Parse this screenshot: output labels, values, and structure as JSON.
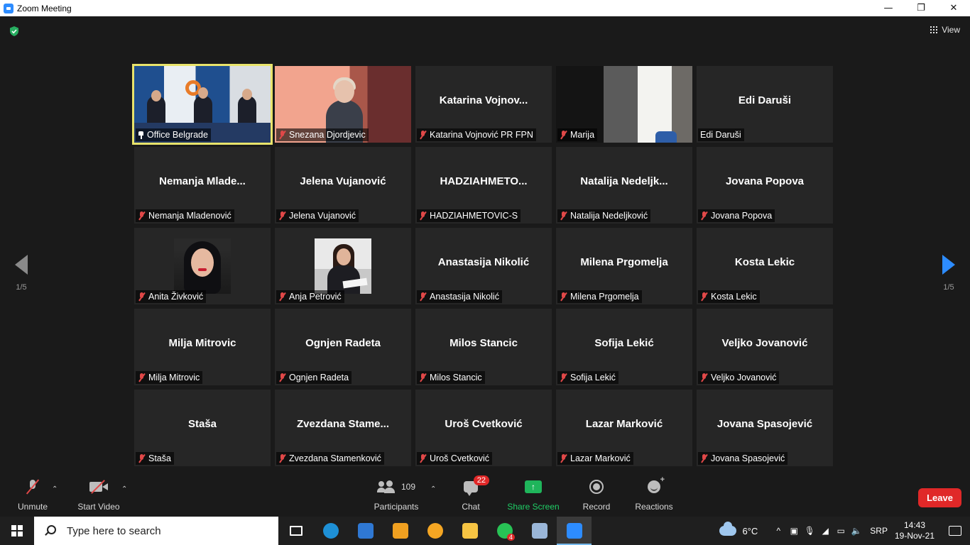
{
  "window": {
    "title": "Zoom Meeting",
    "controls": {
      "minimize": "—",
      "restore": "❐",
      "close": "✕"
    }
  },
  "top": {
    "security_icon": "shield-check-icon",
    "view_label": "View"
  },
  "pager": {
    "left": "1/5",
    "right": "1/5"
  },
  "tiles": [
    {
      "display": "",
      "label": "Office Belgrade",
      "muted": false,
      "video": "office",
      "active": true
    },
    {
      "display": "",
      "label": "Snezana Djordjevic",
      "muted": true,
      "video": "snezana"
    },
    {
      "display": "Katarina  Vojnov...",
      "label": "Katarina Vojnović PR FPN",
      "muted": true
    },
    {
      "display": "",
      "label": "Marija",
      "muted": true,
      "video": "marija"
    },
    {
      "display": "Edi Daruši",
      "label": "Edi Daruši",
      "muted": false
    },
    {
      "display": "Nemanja  Mlade...",
      "label": "Nemanja Mladenović",
      "muted": true
    },
    {
      "display": "Jelena Vujanović",
      "label": "Jelena Vujanović",
      "muted": true
    },
    {
      "display": "HADZIAHMETO...",
      "label": "HADZIAHMETOVIC-S",
      "muted": true
    },
    {
      "display": "Natalija  Nedeljk...",
      "label": "Natalija Nedeljković",
      "muted": true
    },
    {
      "display": "Jovana Popova",
      "label": "Jovana Popova",
      "muted": true
    },
    {
      "display": "",
      "label": "Anita Živković",
      "muted": true,
      "avatar": "anita"
    },
    {
      "display": "",
      "label": "Anja Petrović",
      "muted": true,
      "avatar": "anja"
    },
    {
      "display": "Anastasija Nikolić",
      "label": "Anastasija Nikolić",
      "muted": true
    },
    {
      "display": "Milena Prgomelja",
      "label": "Milena Prgomelja",
      "muted": true
    },
    {
      "display": "Kosta Lekic",
      "label": "Kosta Lekic",
      "muted": true
    },
    {
      "display": "Milja Mitrovic",
      "label": "Milja Mitrovic",
      "muted": true
    },
    {
      "display": "Ognjen Radeta",
      "label": "Ognjen Radeta",
      "muted": true
    },
    {
      "display": "Milos Stancic",
      "label": "Milos Stancic",
      "muted": true
    },
    {
      "display": "Sofija Lekić",
      "label": "Sofija Lekić",
      "muted": true
    },
    {
      "display": "Veljko Jovanović",
      "label": "Veljko Jovanović",
      "muted": true
    },
    {
      "display": "Staša",
      "label": "Staša",
      "muted": true
    },
    {
      "display": "Zvezdana  Stame...",
      "label": "Zvezdana Stamenković",
      "muted": true
    },
    {
      "display": "Uroš Cvetković",
      "label": "Uroš Cvetković",
      "muted": true
    },
    {
      "display": "Lazar Marković",
      "label": "Lazar Marković",
      "muted": true
    },
    {
      "display": "Jovana Spasojević",
      "label": "Jovana Spasojević",
      "muted": true
    }
  ],
  "controls": {
    "unmute": "Unmute",
    "start_video": "Start Video",
    "participants": "Participants",
    "participants_count": "109",
    "chat": "Chat",
    "chat_badge": "22",
    "share_screen": "Share Screen",
    "record": "Record",
    "reactions": "Reactions",
    "leave": "Leave",
    "caret": "⌃"
  },
  "taskbar": {
    "search_placeholder": "Type here to search",
    "apps": [
      {
        "name": "task-view",
        "color": "#ffffff"
      },
      {
        "name": "edge",
        "color": "#1e90d6"
      },
      {
        "name": "mail",
        "color": "#2f78d3"
      },
      {
        "name": "store",
        "color": "#f0a020"
      },
      {
        "name": "brave-vpn",
        "color": "#f5a623"
      },
      {
        "name": "file-explorer",
        "color": "#f6c443"
      },
      {
        "name": "whatsapp",
        "color": "#28c255",
        "badge": "4"
      },
      {
        "name": "paint",
        "color": "#9ab6d8"
      },
      {
        "name": "zoom",
        "color": "#2d8cff",
        "active": true
      }
    ],
    "temperature": "6°C",
    "language": "SRP",
    "time": "14:43",
    "date": "19-Nov-21"
  }
}
